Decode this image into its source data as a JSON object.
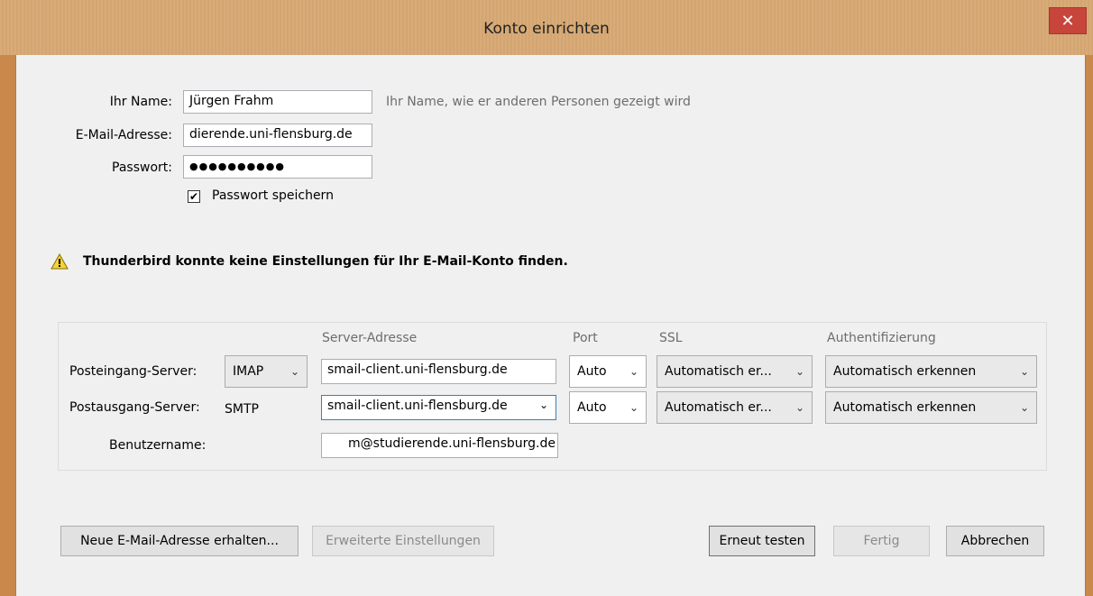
{
  "window": {
    "title": "Konto einrichten",
    "close_label": "✕"
  },
  "form": {
    "name_label": "Ihr Name:",
    "name_value": "Jürgen Frahm",
    "name_hint": "Ihr Name, wie er anderen Personen gezeigt wird",
    "email_label": "E-Mail-Adresse:",
    "email_value": "dierende.uni-flensburg.de",
    "password_label": "Passwort:",
    "password_value": "●●●●●●●●●●",
    "save_password_label": "Passwort speichern",
    "save_password_checked": true
  },
  "warning": {
    "icon": "warning-triangle-icon",
    "text": "Thunderbird konnte keine Einstellungen für Ihr E-Mail-Konto finden."
  },
  "servers": {
    "col_server": "Server-Adresse",
    "col_port": "Port",
    "col_ssl": "SSL",
    "col_auth": "Authentifizierung",
    "incoming": {
      "label": "Posteingang-Server:",
      "protocol": "IMAP",
      "address": "smail-client.uni-flensburg.de",
      "port": "Auto",
      "ssl": "Automatisch er...",
      "auth": "Automatisch erkennen"
    },
    "outgoing": {
      "label": "Postausgang-Server:",
      "protocol": "SMTP",
      "address": "smail-client.uni-flensburg.de",
      "port": "Auto",
      "ssl": "Automatisch er...",
      "auth": "Automatisch erkennen"
    },
    "username": {
      "label": "Benutzername:",
      "value": "m@studierende.uni-flensburg.de"
    }
  },
  "buttons": {
    "new_email": "Neue E-Mail-Adresse erhalten...",
    "advanced": "Erweiterte Einstellungen",
    "retest": "Erneut testen",
    "done": "Fertig",
    "cancel": "Abbrechen"
  },
  "colors": {
    "titlebar": "#d6a873",
    "close": "#c7453b",
    "dialog_bg": "#f0f0f0"
  }
}
